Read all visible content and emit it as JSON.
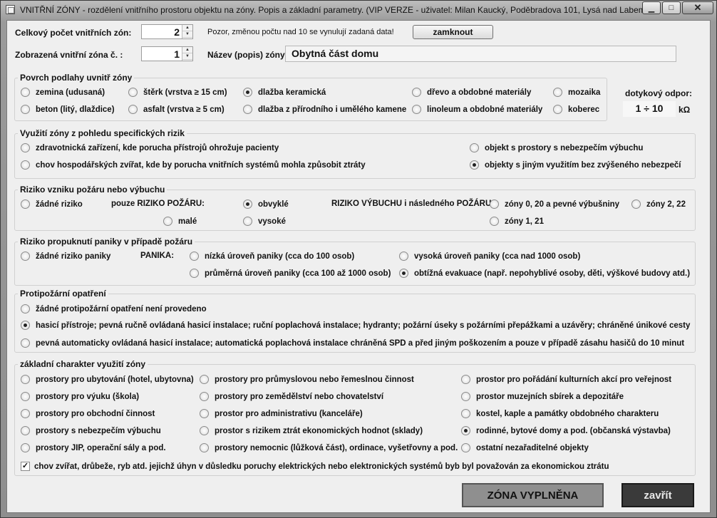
{
  "window": {
    "title": "VNITŘNÍ ZÓNY - rozdělení vnitřního prostoru objektu na zóny. Popis a základní parametry. (VIP VERZE - uživatel: Milan Kaucký, Poděbradova 101, Lysá nad Labem",
    "minimize_glyph": "▁",
    "maximize_glyph": "□",
    "close_glyph": "✕"
  },
  "top": {
    "zone_count_label": "Celkový počet vnitřních zón:",
    "zone_count_value": "2",
    "warning_text": "Pozor, změnou počtu nad 10 se vynulují zadaná data!",
    "lock_button": "zamknout",
    "zone_display_label": "Zobrazená vnitřní zóna č. :",
    "zone_display_value": "1",
    "zone_name_label": "Název (popis) zóny:",
    "zone_name_value": "Obytná část domu",
    "spin_up": "▲",
    "spin_down": "▼"
  },
  "floor": {
    "title": "Povrch podlahy uvnitř zóny",
    "options": [
      {
        "label": "zemina (udusaná)",
        "checked": false
      },
      {
        "label": "štěrk (vrstva ≥ 15 cm)",
        "checked": false
      },
      {
        "label": "dlažba keramická",
        "checked": true
      },
      {
        "label": "dřevo a obdobné materiály",
        "checked": false
      },
      {
        "label": "mozaika",
        "checked": false
      },
      {
        "label": "beton (litý, dlaždice)",
        "checked": false
      },
      {
        "label": "asfalt (vrstva ≥ 5 cm)",
        "checked": false
      },
      {
        "label": "dlažba z přírodního i umělého kamene",
        "checked": false
      },
      {
        "label": "linoleum a obdobné materiály",
        "checked": false
      },
      {
        "label": "koberec",
        "checked": false
      }
    ],
    "contact_label": "dotykový odpor:",
    "contact_value": "1 ÷ 10",
    "contact_unit": "kΩ"
  },
  "risk_use": {
    "title": "Využití zóny z pohledu specifických rizik",
    "options": [
      {
        "label": "zdravotnická zařízení, kde porucha přístrojů ohrožuje pacienty",
        "checked": false
      },
      {
        "label": "objekt s prostory s nebezpečím výbuchu",
        "checked": false
      },
      {
        "label": "chov hospodářských zvířat, kde by porucha vnitřních systémů mohla způsobit ztráty",
        "checked": false
      },
      {
        "label": "objekty s jiným využitím bez zvýšeného nebezpečí",
        "checked": true
      }
    ]
  },
  "fire": {
    "title": "Riziko vzniku požáru nebo výbuchu",
    "none_label": "žádné riziko",
    "fire_only_label": "pouze RIZIKO POŽÁRU:",
    "explosion_label": "RIZIKO VÝBUCHU i následného POŽÁRU:",
    "options": [
      {
        "label": "žádné riziko",
        "checked": false
      },
      {
        "label": "obvyklé",
        "checked": true
      },
      {
        "label": "malé",
        "checked": false
      },
      {
        "label": "vysoké",
        "checked": false
      },
      {
        "label": "zóny 0, 20 a pevné výbušniny",
        "checked": false
      },
      {
        "label": "zóny 2, 22",
        "checked": false
      },
      {
        "label": "zóny 1, 21",
        "checked": false
      }
    ]
  },
  "panic": {
    "title": "Riziko propuknutí paniky v případě  požáru",
    "panic_label": "PANIKA:",
    "options": [
      {
        "label": "žádné riziko paniky",
        "checked": false
      },
      {
        "label": "nízká úroveň paniky (cca do 100 osob)",
        "checked": false
      },
      {
        "label": "vysoká úroveň paniky (cca nad 1000 osob)",
        "checked": false
      },
      {
        "label": "průměrná úroveň paniky (cca 100 až 1000 osob)",
        "checked": false
      },
      {
        "label": "obtížná evakuace (např. nepohyblivé osoby, děti, výškové budovy atd.)",
        "checked": true
      }
    ]
  },
  "protection": {
    "title": "Protipožární opatření",
    "options": [
      {
        "label": "žádné protipožární opatření není provedeno",
        "checked": false
      },
      {
        "label": "hasicí přístroje; pevná ručně ovládaná hasicí instalace; ruční poplachová instalace; hydranty; požární úseky s požárními přepážkami a uzávěry;  chráněné únikové cesty",
        "checked": true
      },
      {
        "label": "pevná automaticky ovládaná hasicí instalace; automatická poplachová instalace chráněná SPD a před jiným poškozením a pouze v případě zásahu hasičů do 10 minut",
        "checked": false
      }
    ]
  },
  "character": {
    "title": "základní charakter využití zóny",
    "options": [
      {
        "label": "prostory pro ubytování (hotel, ubytovna)",
        "checked": false
      },
      {
        "label": "prostory pro průmyslovou nebo řemeslnou činnost",
        "checked": false
      },
      {
        "label": "prostor pro pořádání kulturních akcí pro veřejnost",
        "checked": false
      },
      {
        "label": "prostory pro výuku (škola)",
        "checked": false
      },
      {
        "label": "prostory pro zemědělství nebo chovatelství",
        "checked": false
      },
      {
        "label": "prostor muzejních sbírek a depozitáře",
        "checked": false
      },
      {
        "label": "prostory pro obchodní činnost",
        "checked": false
      },
      {
        "label": "prostor pro administrativu (kanceláře)",
        "checked": false
      },
      {
        "label": "kostel, kaple a památky obdobného charakteru",
        "checked": false
      },
      {
        "label": "prostory s nebezpečím výbuchu",
        "checked": false
      },
      {
        "label": "prostor s rizikem ztrát ekonomických hodnot (sklady)",
        "checked": false
      },
      {
        "label": "rodinné, bytové domy a pod. (občanská výstavba)",
        "checked": true
      },
      {
        "label": "prostory JIP, operační sály a pod.",
        "checked": false
      },
      {
        "label": "prostory nemocnic (lůžková část), ordinace, vyšetřovny a pod.",
        "checked": false
      },
      {
        "label": "ostatní nezařaditelné objekty",
        "checked": false
      }
    ],
    "animals_label": "chov zvířat, drůbeže, ryb atd. jejichž úhyn v důsledku poruchy elektrických nebo elektronických systémů byb byl považován za ekonomickou ztrátu",
    "animals_checked": true,
    "check_mark": "✓"
  },
  "actions": {
    "done_label": "ZÓNA VYPLNĚNA",
    "close_label": "zavřít"
  }
}
